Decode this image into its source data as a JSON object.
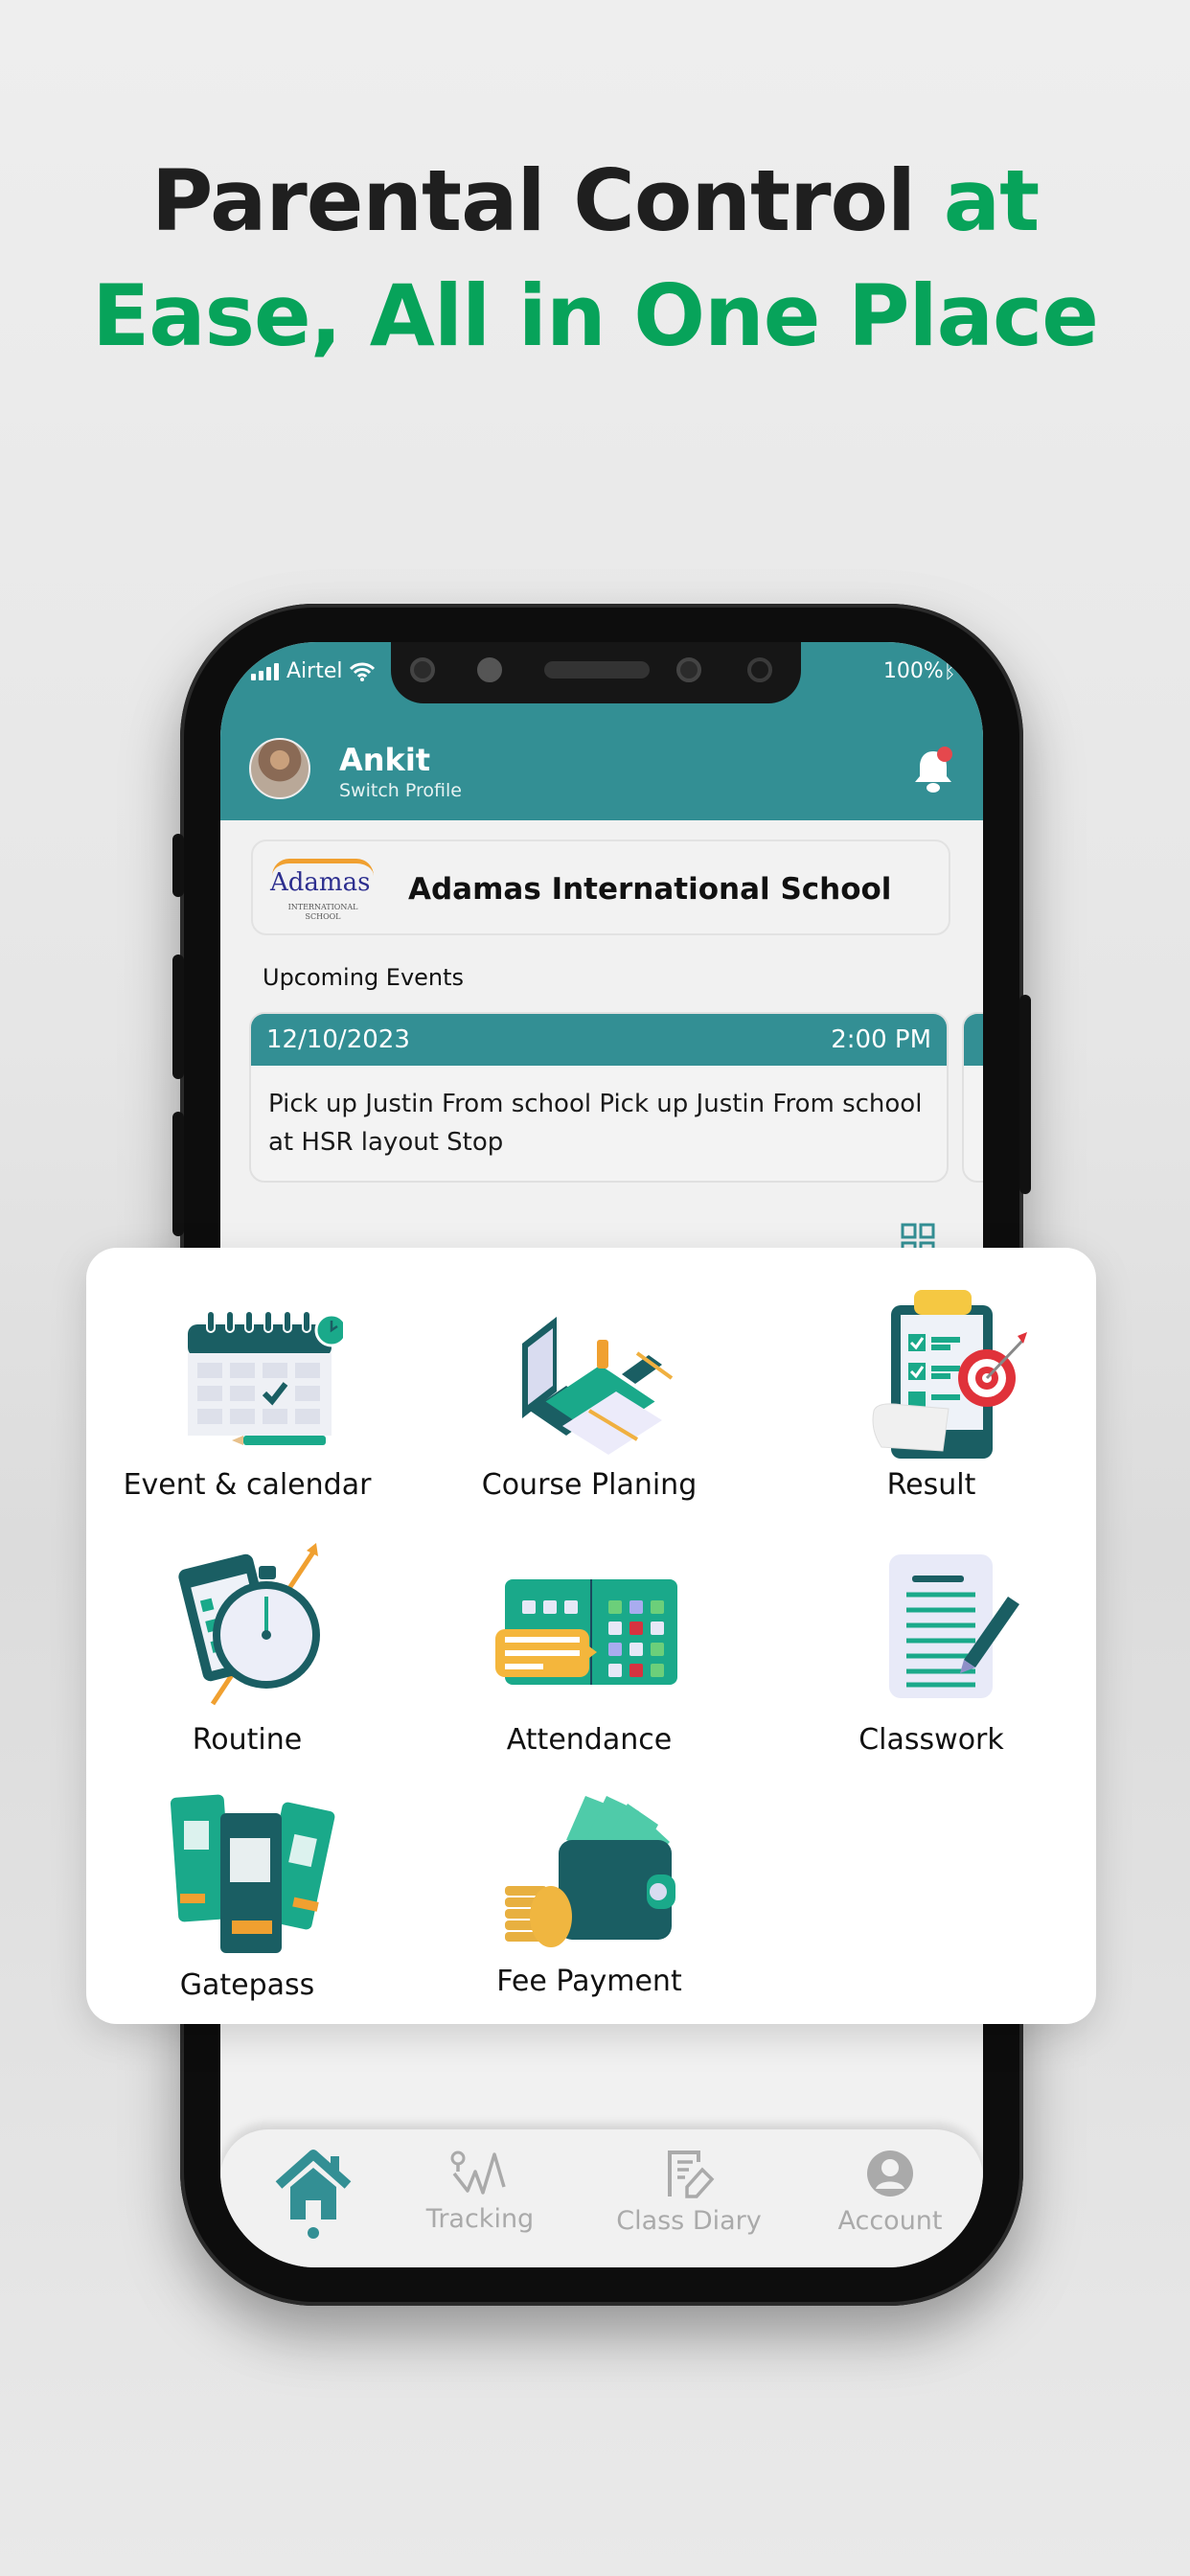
{
  "headline": {
    "line1_dark": "Parental Control ",
    "line1_green": "at",
    "line2_green": "Ease, All in One Place"
  },
  "colors": {
    "brand_teal": "#338f94",
    "headline_green": "#07a35a",
    "headline_dark": "#1f1f1f",
    "notification_dot": "#e5484d",
    "nav_inactive": "#aaaaaa"
  },
  "status_bar": {
    "carrier": "Airtel",
    "battery": "100%",
    "icons": [
      "signal-icon",
      "wifi-icon",
      "bluetooth-icon"
    ]
  },
  "header": {
    "user_name": "Ankit",
    "subtitle": "Switch Profile",
    "notification_icon": "bell-icon",
    "has_unread": true
  },
  "school": {
    "logo_text": "Adamas",
    "logo_sub": "INTERNATIONAL SCHOOL",
    "name": "Adamas International School"
  },
  "upcoming_events": {
    "title": "Upcoming Events",
    "items": [
      {
        "date": "12/10/2023",
        "time": "2:00 PM",
        "description": "Pick up Justin From school Pick up Justin From school  at HSR layout Stop"
      }
    ]
  },
  "menu": {
    "items": [
      {
        "label": "Event & calendar",
        "icon": "calendar-icon"
      },
      {
        "label": "Course Planing",
        "icon": "course-planning-icon"
      },
      {
        "label": "Result",
        "icon": "result-clipboard-icon"
      },
      {
        "label": "Routine",
        "icon": "routine-stopwatch-icon"
      },
      {
        "label": "Attendance",
        "icon": "attendance-icon"
      },
      {
        "label": "Classwork",
        "icon": "classwork-icon"
      },
      {
        "label": "Gatepass",
        "icon": "gatepass-icon"
      },
      {
        "label": "Fee Payment",
        "icon": "wallet-icon"
      }
    ]
  },
  "bottom_nav": {
    "items": [
      {
        "label": "",
        "icon": "home-icon",
        "active": true
      },
      {
        "label": "Tracking",
        "icon": "tracking-icon",
        "active": false
      },
      {
        "label": "Class Diary",
        "icon": "class-diary-icon",
        "active": false
      },
      {
        "label": "Account",
        "icon": "account-icon",
        "active": false
      }
    ]
  }
}
